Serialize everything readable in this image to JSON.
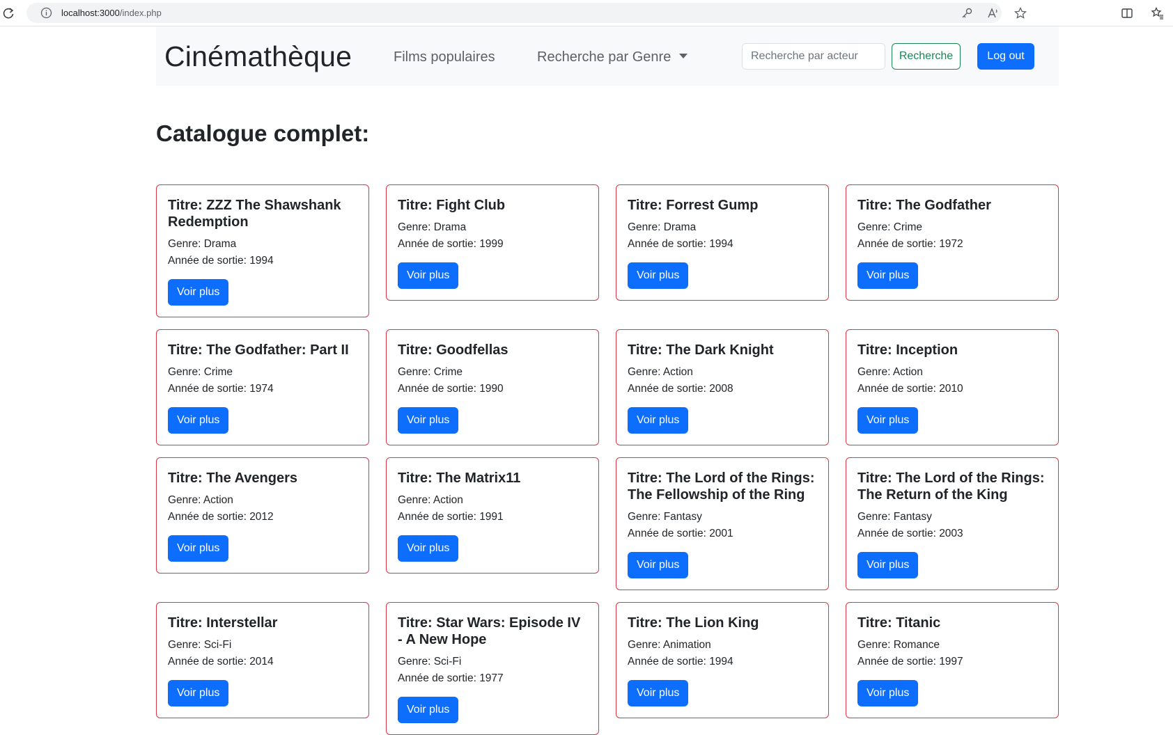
{
  "browser": {
    "url_host": "localhost:3000",
    "url_path": "/index.php"
  },
  "navbar": {
    "brand": "Cinémathèque",
    "popular_label": "Films populaires",
    "genre_label": "Recherche par Genre",
    "search_placeholder": "Recherche par acteur",
    "search_button": "Recherche",
    "logout_button": "Log out"
  },
  "page_title": "Catalogue complet:",
  "labels": {
    "title_prefix": "Titre: ",
    "genre_prefix": "Genre: ",
    "year_prefix": "Année de sortie: ",
    "more_button": "Voir plus"
  },
  "films": [
    {
      "title": "ZZZ The Shawshank Redemption",
      "genre": "Drama",
      "year": "1994"
    },
    {
      "title": "Fight Club",
      "genre": "Drama",
      "year": "1999"
    },
    {
      "title": "Forrest Gump",
      "genre": "Drama",
      "year": "1994"
    },
    {
      "title": "The Godfather",
      "genre": "Crime",
      "year": "1972"
    },
    {
      "title": "The Godfather: Part II",
      "genre": "Crime",
      "year": "1974"
    },
    {
      "title": "Goodfellas",
      "genre": "Crime",
      "year": "1990"
    },
    {
      "title": "The Dark Knight",
      "genre": "Action",
      "year": "2008"
    },
    {
      "title": "Inception",
      "genre": "Action",
      "year": "2010"
    },
    {
      "title": "The Avengers",
      "genre": "Action",
      "year": "2012"
    },
    {
      "title": "The Matrix11",
      "genre": "Action",
      "year": "1991"
    },
    {
      "title": "The Lord of the Rings: The Fellowship of the Ring",
      "genre": "Fantasy",
      "year": "2001"
    },
    {
      "title": "The Lord of the Rings: The Return of the King",
      "genre": "Fantasy",
      "year": "2003"
    },
    {
      "title": "Interstellar",
      "genre": "Sci-Fi",
      "year": "2014"
    },
    {
      "title": "Star Wars: Episode IV - A New Hope",
      "genre": "Sci-Fi",
      "year": "1977"
    },
    {
      "title": "The Lion King",
      "genre": "Animation",
      "year": "1994"
    },
    {
      "title": "Titanic",
      "genre": "Romance",
      "year": "1997"
    }
  ],
  "colors": {
    "primary": "#0d6efd",
    "success": "#198754",
    "danger": "#dc3545",
    "navbar_bg": "#f8f9fa"
  },
  "icons": [
    "reload-icon",
    "info-icon",
    "key-icon",
    "read-aloud-icon",
    "favorite-star-icon",
    "split-screen-icon",
    "favorites-icon",
    "caret-down-icon"
  ]
}
